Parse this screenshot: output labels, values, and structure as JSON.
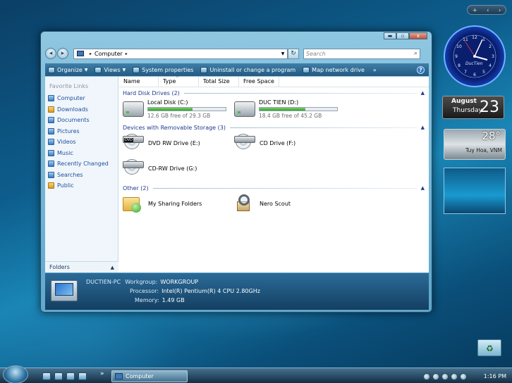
{
  "window": {
    "title": "Computer",
    "controls": {
      "minimize": "▬",
      "maximize": "▫",
      "close": "x"
    },
    "address": {
      "root": "Computer",
      "chevron": "▸"
    },
    "search": {
      "placeholder": "Search"
    }
  },
  "toolbar": {
    "items": [
      {
        "label": "Organize",
        "has_caret": true,
        "icon": "organize-icon"
      },
      {
        "label": "Views",
        "has_caret": true,
        "icon": "views-icon"
      },
      {
        "label": "System properties",
        "icon": "system-properties-icon"
      },
      {
        "label": "Uninstall or change a program",
        "icon": "uninstall-icon"
      },
      {
        "label": "Map network drive",
        "icon": "map-network-drive-icon"
      }
    ],
    "more": "»",
    "help": "?"
  },
  "nav": {
    "favorite_title": "Favorite Links",
    "items": [
      {
        "label": "Computer"
      },
      {
        "label": "Downloads"
      },
      {
        "label": "Documents"
      },
      {
        "label": "Pictures"
      },
      {
        "label": "Videos"
      },
      {
        "label": "Music"
      },
      {
        "label": "Recently Changed"
      },
      {
        "label": "Searches"
      },
      {
        "label": "Public"
      }
    ],
    "folders_label": "Folders"
  },
  "columns": [
    "Name",
    "Type",
    "Total Size",
    "Free Space"
  ],
  "groups": {
    "hard_disk": {
      "title": "Hard Disk Drives (2)",
      "drives": [
        {
          "name": "Local Disk (C:)",
          "free_text": "12.6 GB free of 29.3 GB",
          "used_fraction": 0.57
        },
        {
          "name": "DUC TIEN (D:)",
          "free_text": "18.4 GB free of 45.2 GB",
          "used_fraction": 0.59
        }
      ]
    },
    "removable": {
      "title": "Devices with Removable Storage (3)",
      "items": [
        {
          "name": "DVD RW Drive (E:)",
          "tag": "DVD"
        },
        {
          "name": "CD Drive (F:)"
        },
        {
          "name": "CD-RW Drive (G:)"
        }
      ]
    },
    "other": {
      "title": "Other (2)",
      "items": [
        {
          "name": "My Sharing Folders"
        },
        {
          "name": "Nero Scout"
        }
      ]
    }
  },
  "details": {
    "pc_name": "DUCTIEN-PC",
    "workgroup_label": "Workgroup:",
    "workgroup": "WORKGROUP",
    "processor_label": "Processor:",
    "processor": "Intel(R) Pentium(R) 4 CPU 2.80GHz",
    "memory_label": "Memory:",
    "memory": "1.49 GB"
  },
  "gadgets": {
    "clock_label": "DucTien",
    "calendar": {
      "month": "August",
      "weekday": "Thursday",
      "day": "23"
    },
    "weather": {
      "temp": "28°",
      "location": "Tuy Hoa, VNM"
    }
  },
  "taskbar": {
    "task_label": "Computer",
    "quicklaunch_more": "»",
    "clock": "1:16 PM"
  }
}
